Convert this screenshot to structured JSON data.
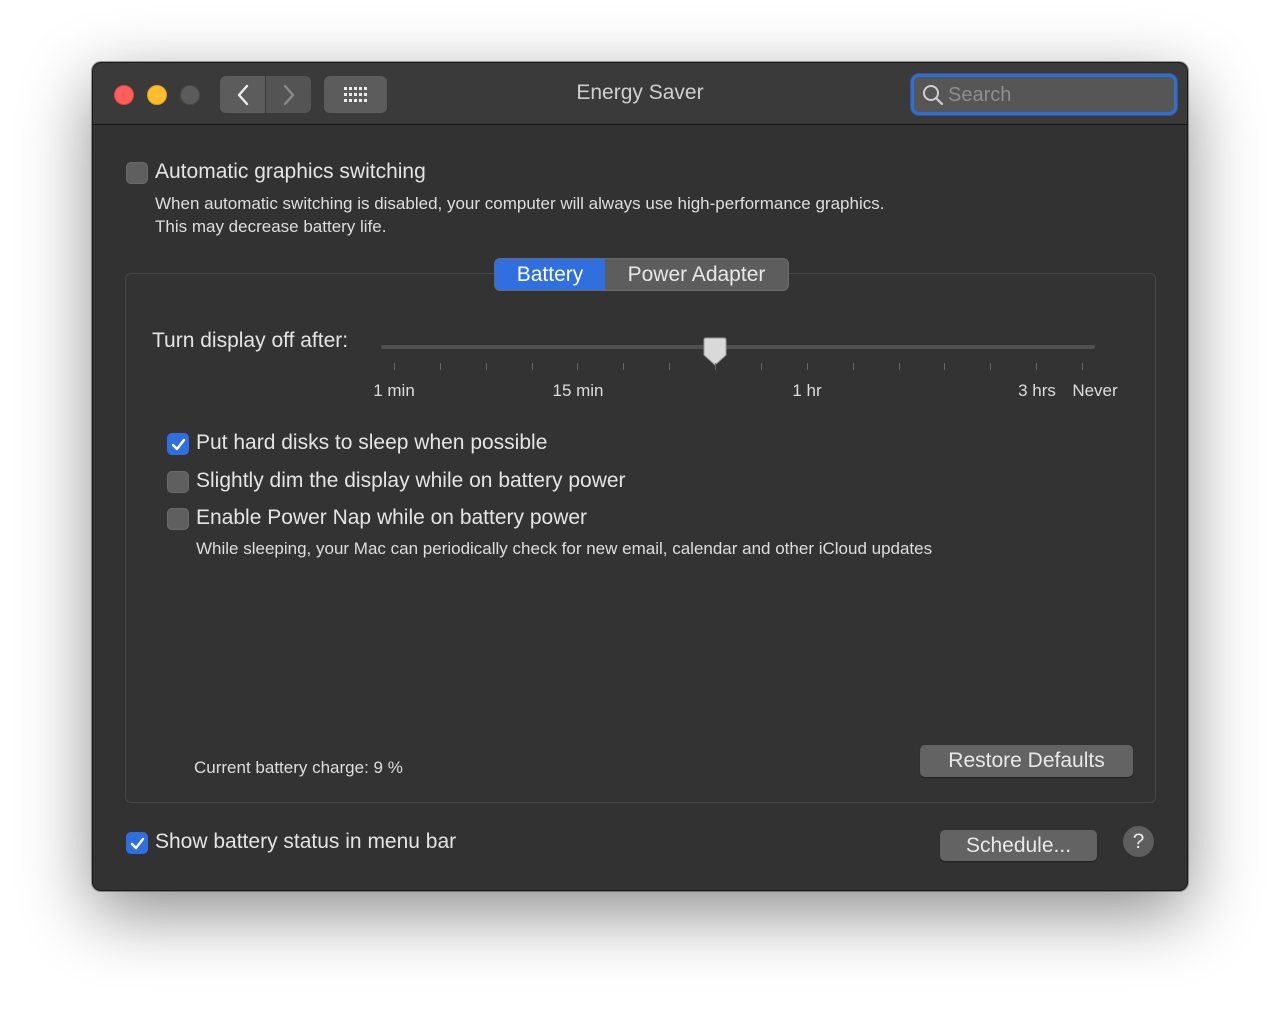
{
  "window": {
    "title": "Energy Saver"
  },
  "toolbar": {
    "back_icon": "chevron-left-icon",
    "forward_icon": "chevron-right-icon",
    "grid_icon": "show-all-grid-icon"
  },
  "search": {
    "placeholder": "Search",
    "value": ""
  },
  "graphics": {
    "checkbox_label": "Automatic graphics switching",
    "checked": false,
    "description_line1": "When automatic switching is disabled, your computer will always use high-performance graphics.",
    "description_line2": "This may decrease battery life."
  },
  "tabs": [
    {
      "label": "Battery",
      "active": true
    },
    {
      "label": "Power Adapter",
      "active": false
    }
  ],
  "display_slider": {
    "label": "Turn display off after:",
    "tick_labels": [
      "1 min",
      "15 min",
      "1 hr",
      "3 hrs",
      "Never"
    ],
    "tick_count": 16,
    "selected_tick_index": 7
  },
  "options": [
    {
      "label": "Put hard disks to sleep when possible",
      "checked": true
    },
    {
      "label": "Slightly dim the display while on battery power",
      "checked": false
    },
    {
      "label": "Enable Power Nap while on battery power",
      "checked": false,
      "description": "While sleeping, your Mac can periodically check for new email, calendar and other iCloud updates"
    }
  ],
  "battery_charge": "Current battery charge: 9 %",
  "buttons": {
    "restore_defaults": "Restore Defaults",
    "schedule": "Schedule...",
    "help": "?"
  },
  "menu_bar": {
    "label": "Show battery status in menu bar",
    "checked": true
  },
  "colors": {
    "accent": "#2f6fe0",
    "close": "#ff5f57",
    "minimize": "#febc2e",
    "window_bg": "#323232"
  }
}
